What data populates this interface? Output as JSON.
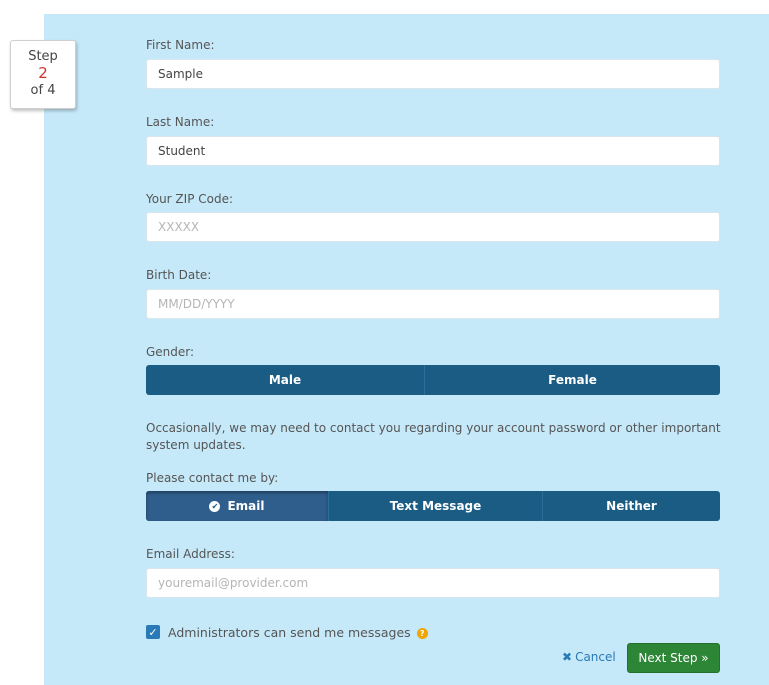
{
  "step": {
    "word": "Step",
    "current": "2",
    "of": "of 4"
  },
  "fields": {
    "first_name": {
      "label": "First Name:",
      "value": "Sample"
    },
    "last_name": {
      "label": "Last Name:",
      "value": "Student"
    },
    "zip": {
      "label": "Your ZIP Code:",
      "placeholder": "XXXXX"
    },
    "birth_date": {
      "label": "Birth Date:",
      "placeholder": "MM/DD/YYYY"
    },
    "email": {
      "label": "Email Address:",
      "placeholder": "youremail@provider.com"
    }
  },
  "gender": {
    "label": "Gender:",
    "options": [
      "Male",
      "Female"
    ]
  },
  "contact": {
    "info": "Occasionally, we may need to contact you regarding your account password or other important system updates.",
    "label": "Please contact me by:",
    "options": [
      "Email",
      "Text Message",
      "Neither"
    ],
    "selected": "Email"
  },
  "admin_checkbox": {
    "label": "Administrators can send me messages",
    "checked": true
  },
  "actions": {
    "cancel": "Cancel",
    "next": "Next Step »"
  },
  "colors": {
    "panel": "#c6e9f9",
    "segment": "#1b5c85",
    "next": "#2d8536",
    "link": "#2a7ab7",
    "step_number": "#d0342c"
  }
}
